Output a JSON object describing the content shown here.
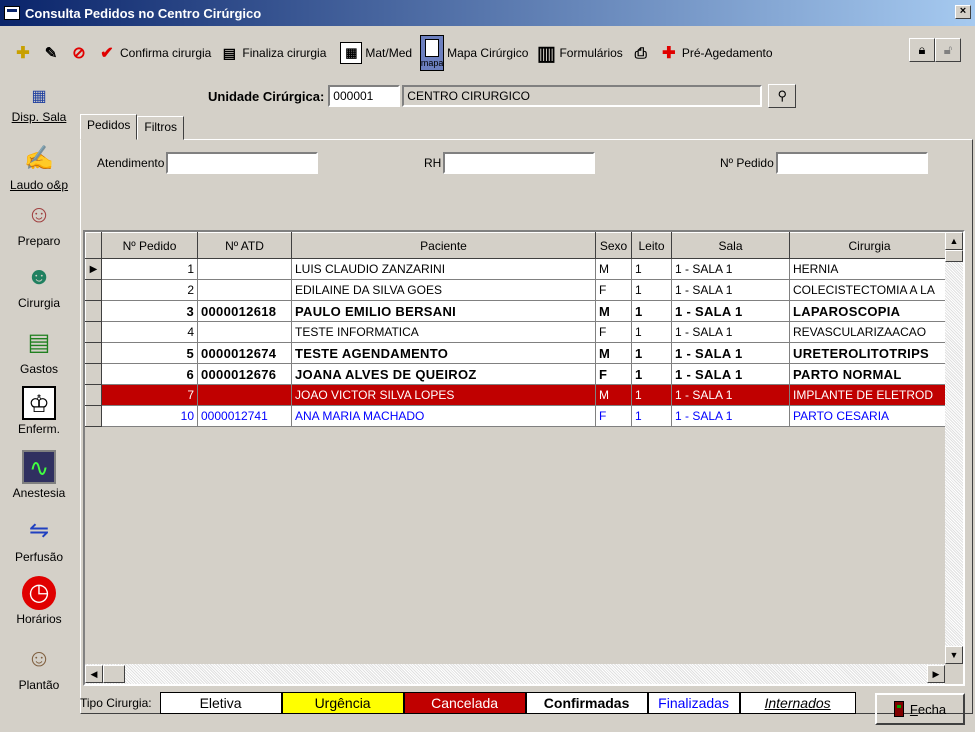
{
  "window": {
    "title": "Consulta Pedidos no Centro Cirúrgico",
    "close_glyph": "×"
  },
  "toolbar": {
    "confirma": "Confirma cirurgia",
    "finaliza": "Finaliza cirurgia",
    "matmed": "Mat/Med",
    "mapa_icon_label": "mapa",
    "mapa": "Mapa Cirúrgico",
    "formularios": "Formulários",
    "pre_agendamento": "Pré-Agedamento"
  },
  "sidebar": {
    "items": [
      {
        "label": "Disp. Sala",
        "icon": "calendar-icon",
        "glyph": "▦"
      },
      {
        "label": "Laudo o&p",
        "icon": "writing-hand-icon",
        "glyph": "✍"
      },
      {
        "label": "Preparo",
        "icon": "nurse-icon",
        "glyph": "☺"
      },
      {
        "label": "Cirurgia",
        "icon": "surgeon-icon",
        "glyph": "☻"
      },
      {
        "label": "Gastos",
        "icon": "ledger-money-icon",
        "glyph": "▤"
      },
      {
        "label": "Enferm.",
        "icon": "bell-icon",
        "glyph": "♔"
      },
      {
        "label": "Anestesia",
        "icon": "monitor-icon",
        "glyph": "∿"
      },
      {
        "label": "Perfusão",
        "icon": "o2-co2-icon",
        "glyph": "⇋"
      },
      {
        "label": "Horários",
        "icon": "clock-icon",
        "glyph": "◷"
      },
      {
        "label": "Plantão",
        "icon": "doctor-icon",
        "glyph": "☺"
      }
    ]
  },
  "unit": {
    "label": "Unidade Cirúrgica:",
    "code": "000001",
    "name": "CENTRO CIRURGICO"
  },
  "tabs": {
    "pedidos": "Pedidos",
    "filtros": "Filtros"
  },
  "filters": {
    "atendimento_label": "Atendimento",
    "atendimento_value": "",
    "rh_label": "RH",
    "rh_value": "",
    "pedido_label": "Nº Pedido",
    "pedido_value": ""
  },
  "grid": {
    "columns": [
      "Nº Pedido",
      "Nº ATD",
      "Paciente",
      "Sexo",
      "Leito",
      "Sala",
      "Cirurgia"
    ],
    "rows": [
      {
        "pedido": "1",
        "atd": "",
        "paciente": "LUIS CLAUDIO ZANZARINI",
        "sexo": "M",
        "leito": "1",
        "sala": "1 - SALA 1",
        "cirurgia": "HERNIA"
      },
      {
        "pedido": "2",
        "atd": "",
        "paciente": "EDILAINE DA SILVA GOES",
        "sexo": "F",
        "leito": "1",
        "sala": "1 - SALA 1",
        "cirurgia": "COLECISTECTOMIA A LA"
      },
      {
        "pedido": "3",
        "atd": "0000012618",
        "paciente": "PAULO EMILIO BERSANI",
        "sexo": "M",
        "leito": "1",
        "sala": "1 - SALA 1",
        "cirurgia": "LAPAROSCOPIA"
      },
      {
        "pedido": "4",
        "atd": "",
        "paciente": "TESTE INFORMATICA",
        "sexo": "F",
        "leito": "1",
        "sala": "1 - SALA 1",
        "cirurgia": "REVASCULARIZAACAO"
      },
      {
        "pedido": "5",
        "atd": "0000012674",
        "paciente": "TESTE AGENDAMENTO",
        "sexo": "M",
        "leito": "1",
        "sala": "1 - SALA 1",
        "cirurgia": "URETEROLITOTRIPS"
      },
      {
        "pedido": "6",
        "atd": "0000012676",
        "paciente": "JOANA ALVES DE QUEIROZ",
        "sexo": "F",
        "leito": "1",
        "sala": "1 - SALA 1",
        "cirurgia": "PARTO NORMAL"
      },
      {
        "pedido": "7",
        "atd": "",
        "paciente": "JOAO VICTOR SILVA LOPES",
        "sexo": "M",
        "leito": "1",
        "sala": "1 - SALA 1",
        "cirurgia": "IMPLANTE DE ELETROD"
      },
      {
        "pedido": "10",
        "atd": "0000012741",
        "paciente": "ANA MARIA MACHADO",
        "sexo": "F",
        "leito": "1",
        "sala": "1 - SALA 1",
        "cirurgia": "PARTO CESARIA"
      }
    ],
    "row_indicator": "▶"
  },
  "legend": {
    "label": "Tipo Cirurgia:",
    "eletiva": "Eletiva",
    "urgencia": "Urgência",
    "cancelada": "Cancelada",
    "confirmadas": "Confirmadas",
    "finalizadas": "Finalizadas",
    "internados": "Internados",
    "colors": {
      "eletiva": "#ffffff",
      "urgencia": "#ffff00",
      "cancelada": "#c00000",
      "finalizadas": "#0000ff"
    }
  },
  "footer": {
    "fecha_accel": "F",
    "fecha_rest": "echa"
  }
}
